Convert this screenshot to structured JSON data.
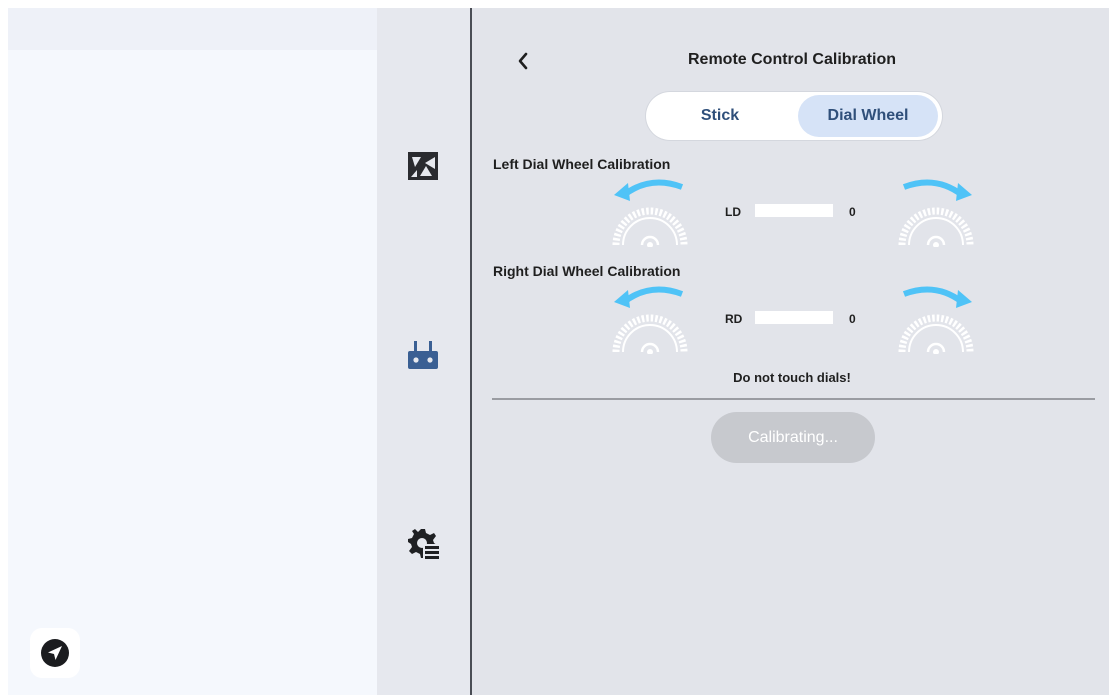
{
  "header": {
    "title": "Remote Control Calibration",
    "back_icon": "chevron-left-icon"
  },
  "tabs": [
    {
      "label": "Stick",
      "selected": false
    },
    {
      "label": "Dial Wheel",
      "selected": true
    }
  ],
  "left_dial": {
    "title": "Left Dial Wheel Calibration",
    "label": "LD",
    "value": "0"
  },
  "right_dial": {
    "title": "Right Dial Wheel Calibration",
    "label": "RD",
    "value": "0"
  },
  "warning": "Do not touch dials!",
  "action_button": {
    "label": "Calibrating...",
    "enabled": false
  },
  "rail_icons": [
    "gimbal-camera-icon",
    "remote-controller-icon",
    "settings-list-icon"
  ],
  "fab_icon": "send-icon",
  "colors": {
    "accent_arrow": "#4fc3f7",
    "selected_tab_bg": "#d6e3f7",
    "tab_text": "#2f4f7a",
    "disabled_button": "#c7c9ce"
  }
}
